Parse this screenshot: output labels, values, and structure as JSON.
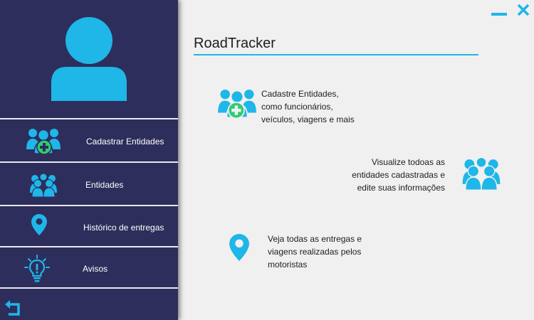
{
  "app": {
    "title": "RoadTracker"
  },
  "colors": {
    "sidebar_bg": "#2e2e5c",
    "accent": "#1fb6e8",
    "plus_green": "#2ecc71",
    "content_bg": "#f0f0f0"
  },
  "sidebar": {
    "avatar_icon": "user-avatar-icon",
    "items": [
      {
        "label": "Cadastrar Entidades",
        "icon": "add-group-icon"
      },
      {
        "label": "Entidades",
        "icon": "group-icon"
      },
      {
        "label": "Histórico de entregas",
        "icon": "map-pin-icon"
      },
      {
        "label": "Avisos",
        "icon": "lightbulb-icon"
      }
    ],
    "back_icon": "back-arrow-icon"
  },
  "window_controls": {
    "minimize_icon": "minimize-icon",
    "close_icon": "close-icon"
  },
  "features": [
    {
      "lines": [
        "Cadastre Entidades,",
        "como funcionários,",
        "veículos, viagens e mais"
      ],
      "icon": "add-group-icon"
    },
    {
      "lines": [
        "Visualize todoas as",
        "entidades cadastradas e",
        "edite suas informações"
      ],
      "icon": "group-icon"
    },
    {
      "lines": [
        "Veja todas as entregas e",
        "viagens realizadas pelos",
        "motoristas"
      ],
      "icon": "map-pin-icon"
    }
  ]
}
